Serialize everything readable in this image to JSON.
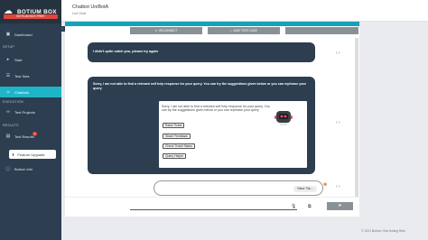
{
  "sidebar": {
    "brand_title": "BOTIUM BOX",
    "badge_label": "BOTIUM BOX FREE",
    "dashboard": "Dashboard",
    "setup_section": "SETUP",
    "start": "Start",
    "test_sets": "Test Sets",
    "chatbots": "Chatbots",
    "execution_section": "EXECUTION",
    "test_projects": "Test Projects",
    "results_section": "RESULTS",
    "test_results": "Test Results",
    "test_results_count": "2",
    "feature_upgrade": "Feature Upgrade",
    "botium_info": "Botium Info"
  },
  "header": {
    "title": "Chatbot UniBotA",
    "subtitle": "Live Chat"
  },
  "toolbar": {
    "reconnect": "RECONNECT",
    "save_test_case": "SAVE TEST CASE",
    "third": ""
  },
  "messages": {
    "bot1": "I didn't quite catch you, please try again",
    "bot2": "Sorry, I am not able to find a relevant self help response for your query. You can try the suggestions given below or you can rephrase your query",
    "card_text": "Sorry, I am not able to find a relevant self help response for your query. You can try the suggestions given below or you can rephrase your query",
    "options": [
      "Raise Ticket",
      "Share Feedback",
      "Check Ticket Status",
      "Query Helper"
    ],
    "user": "Raise Tick..."
  },
  "composer": {
    "placeholder": ""
  },
  "footer": "© 2021 Botium, Box testing Bots"
}
